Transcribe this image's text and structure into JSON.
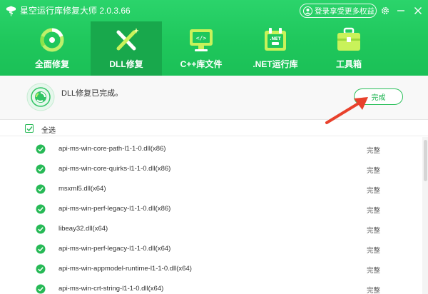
{
  "app": {
    "title": "星空运行库修复大师 2.0.3.66",
    "login_label": "登录享受更多权益"
  },
  "nav": {
    "items": [
      {
        "label": "全面修复",
        "icon": "recycle-icon"
      },
      {
        "label": "DLL修复",
        "icon": "repair-tools-icon"
      },
      {
        "label": "C++库文件",
        "icon": "code-monitor-icon"
      },
      {
        "label": ".NET运行库",
        "icon": "net-calendar-icon"
      },
      {
        "label": "工具箱",
        "icon": "toolbox-icon"
      }
    ],
    "active_index": 1
  },
  "status": {
    "message": "DLL修复已完成。",
    "done_button": "完成"
  },
  "list": {
    "select_all_label": "全选",
    "rows": [
      {
        "name": "api-ms-win-core-path-l1-1-0.dll(x86)",
        "status": "完整"
      },
      {
        "name": "api-ms-win-core-quirks-l1-1-0.dll(x86)",
        "status": "完整"
      },
      {
        "name": "msxml5.dll(x64)",
        "status": "完整"
      },
      {
        "name": "api-ms-win-perf-legacy-l1-1-0.dll(x86)",
        "status": "完整"
      },
      {
        "name": "libeay32.dll(x64)",
        "status": "完整"
      },
      {
        "name": "api-ms-win-perf-legacy-l1-1-0.dll(x64)",
        "status": "完整"
      },
      {
        "name": "api-ms-win-appmodel-runtime-l1-1-0.dll(x64)",
        "status": "完整"
      },
      {
        "name": "api-ms-win-crt-string-l1-1-0.dll(x64)",
        "status": "完整"
      }
    ]
  },
  "colors": {
    "brand_green": "#1fc75c",
    "active_tab": "#18a84c",
    "annotation_arrow": "#e8412c"
  }
}
